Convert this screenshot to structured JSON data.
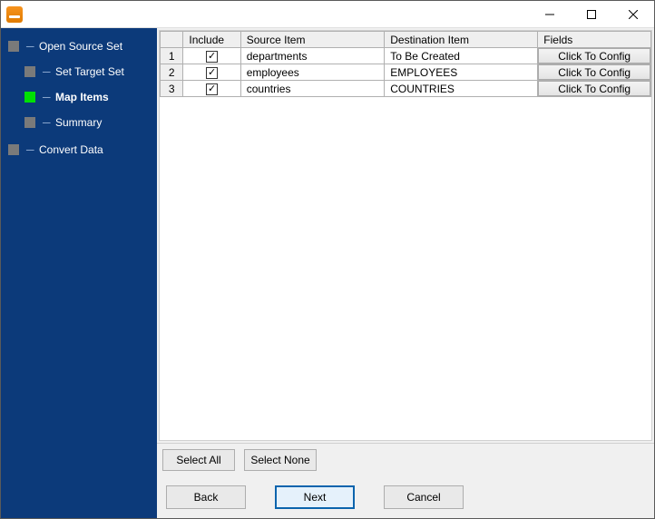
{
  "sidebar": {
    "root1": "Open Source Set",
    "items": [
      {
        "label": "Set Target Set",
        "active": false
      },
      {
        "label": "Map Items",
        "active": true
      },
      {
        "label": "Summary",
        "active": false
      }
    ],
    "root2": "Convert Data"
  },
  "grid": {
    "headers": {
      "rownum": "",
      "include": "Include",
      "source": "Source Item",
      "dest": "Destination Item",
      "fields": "Fields"
    },
    "rows": [
      {
        "n": "1",
        "include": true,
        "source": "departments",
        "dest": "To Be Created",
        "fields_btn": "Click To Config"
      },
      {
        "n": "2",
        "include": true,
        "source": "employees",
        "dest": "EMPLOYEES",
        "fields_btn": "Click To Config"
      },
      {
        "n": "3",
        "include": true,
        "source": "countries",
        "dest": "COUNTRIES",
        "fields_btn": "Click To Config"
      }
    ]
  },
  "buttons": {
    "select_all": "Select All",
    "select_none": "Select None",
    "back": "Back",
    "next": "Next",
    "cancel": "Cancel"
  }
}
